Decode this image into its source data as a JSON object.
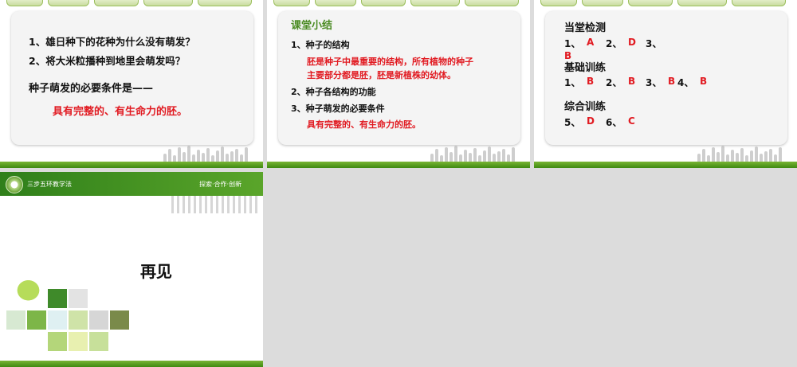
{
  "slide1": {
    "questions": [
      "1、雄日种下的花种为什么没有萌发？",
      "2、将大米粒播种到地里会萌发吗？"
    ],
    "condition_label": "种子萌发的必要条件是——",
    "answer": "具有完整的、有生命力的胚。"
  },
  "slide2": {
    "title": "课堂小结",
    "item1": "1、种子的结构",
    "item1_detail_line1": "胚是种子中最重要的结构，所有植物的种子",
    "item1_detail_line2": "主要部分都是胚，胚是新植株的幼体。",
    "item2": "2、种子各结构的功能",
    "item3": "3、种子萌发的必要条件",
    "item3_detail": "具有完整的、有生命力的胚。"
  },
  "slide3": {
    "title": "当堂检测",
    "row1": [
      {
        "num": "1、",
        "ans": "A"
      },
      {
        "num": "2、",
        "ans": "D"
      },
      {
        "num": "3、",
        "ans": "B"
      }
    ],
    "basic_title": "基础训练",
    "row2": [
      {
        "num": "1、",
        "ans": "B"
      },
      {
        "num": "2、",
        "ans": "B"
      },
      {
        "num": "3、",
        "ans": "B"
      },
      {
        "num": "4、",
        "ans": "B"
      }
    ],
    "comprehensive_title": "综合训练",
    "row3": [
      {
        "num": "5、",
        "ans": "D"
      },
      {
        "num": "6、",
        "ans": "C"
      }
    ]
  },
  "slide4": {
    "brand": "三步五环教学法",
    "slogan": "探索·合作·创新",
    "farewell": "再见"
  },
  "colors": {
    "accent_green": "#3f8a12",
    "answer_red": "#e11b22",
    "title_green": "#4a8b22"
  }
}
